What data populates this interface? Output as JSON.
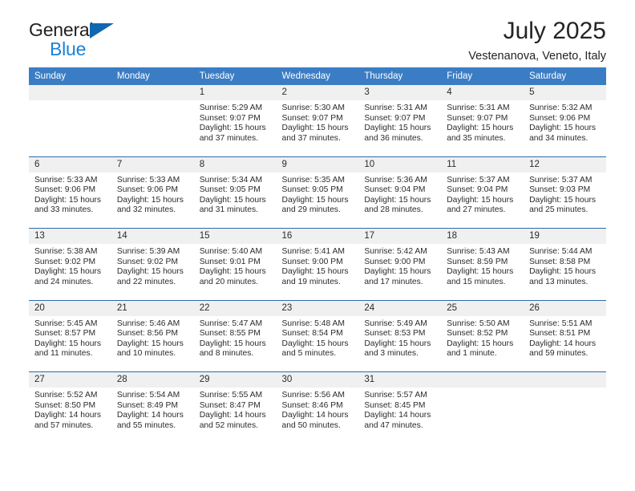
{
  "brand": {
    "line1": "General",
    "line2": "Blue",
    "triangle_color": "#0f67b1",
    "blue_text_color": "#1a82d6"
  },
  "header": {
    "month_title": "July 2025",
    "location": "Vestenanova, Veneto, Italy"
  },
  "theme": {
    "header_band": "#3b7dc4",
    "cell_top_border": "#2d6ca9",
    "daynum_band": "#f0f0f0"
  },
  "weekday_headers": [
    "Sunday",
    "Monday",
    "Tuesday",
    "Wednesday",
    "Thursday",
    "Friday",
    "Saturday"
  ],
  "weeks": [
    [
      {
        "day": "",
        "sunrise": "",
        "sunset": "",
        "daylight": "",
        "empty": true
      },
      {
        "day": "",
        "sunrise": "",
        "sunset": "",
        "daylight": "",
        "empty": true
      },
      {
        "day": "1",
        "sunrise": "Sunrise: 5:29 AM",
        "sunset": "Sunset: 9:07 PM",
        "daylight": "Daylight: 15 hours and 37 minutes."
      },
      {
        "day": "2",
        "sunrise": "Sunrise: 5:30 AM",
        "sunset": "Sunset: 9:07 PM",
        "daylight": "Daylight: 15 hours and 37 minutes."
      },
      {
        "day": "3",
        "sunrise": "Sunrise: 5:31 AM",
        "sunset": "Sunset: 9:07 PM",
        "daylight": "Daylight: 15 hours and 36 minutes."
      },
      {
        "day": "4",
        "sunrise": "Sunrise: 5:31 AM",
        "sunset": "Sunset: 9:07 PM",
        "daylight": "Daylight: 15 hours and 35 minutes."
      },
      {
        "day": "5",
        "sunrise": "Sunrise: 5:32 AM",
        "sunset": "Sunset: 9:06 PM",
        "daylight": "Daylight: 15 hours and 34 minutes."
      }
    ],
    [
      {
        "day": "6",
        "sunrise": "Sunrise: 5:33 AM",
        "sunset": "Sunset: 9:06 PM",
        "daylight": "Daylight: 15 hours and 33 minutes."
      },
      {
        "day": "7",
        "sunrise": "Sunrise: 5:33 AM",
        "sunset": "Sunset: 9:06 PM",
        "daylight": "Daylight: 15 hours and 32 minutes."
      },
      {
        "day": "8",
        "sunrise": "Sunrise: 5:34 AM",
        "sunset": "Sunset: 9:05 PM",
        "daylight": "Daylight: 15 hours and 31 minutes."
      },
      {
        "day": "9",
        "sunrise": "Sunrise: 5:35 AM",
        "sunset": "Sunset: 9:05 PM",
        "daylight": "Daylight: 15 hours and 29 minutes."
      },
      {
        "day": "10",
        "sunrise": "Sunrise: 5:36 AM",
        "sunset": "Sunset: 9:04 PM",
        "daylight": "Daylight: 15 hours and 28 minutes."
      },
      {
        "day": "11",
        "sunrise": "Sunrise: 5:37 AM",
        "sunset": "Sunset: 9:04 PM",
        "daylight": "Daylight: 15 hours and 27 minutes."
      },
      {
        "day": "12",
        "sunrise": "Sunrise: 5:37 AM",
        "sunset": "Sunset: 9:03 PM",
        "daylight": "Daylight: 15 hours and 25 minutes."
      }
    ],
    [
      {
        "day": "13",
        "sunrise": "Sunrise: 5:38 AM",
        "sunset": "Sunset: 9:02 PM",
        "daylight": "Daylight: 15 hours and 24 minutes."
      },
      {
        "day": "14",
        "sunrise": "Sunrise: 5:39 AM",
        "sunset": "Sunset: 9:02 PM",
        "daylight": "Daylight: 15 hours and 22 minutes."
      },
      {
        "day": "15",
        "sunrise": "Sunrise: 5:40 AM",
        "sunset": "Sunset: 9:01 PM",
        "daylight": "Daylight: 15 hours and 20 minutes."
      },
      {
        "day": "16",
        "sunrise": "Sunrise: 5:41 AM",
        "sunset": "Sunset: 9:00 PM",
        "daylight": "Daylight: 15 hours and 19 minutes."
      },
      {
        "day": "17",
        "sunrise": "Sunrise: 5:42 AM",
        "sunset": "Sunset: 9:00 PM",
        "daylight": "Daylight: 15 hours and 17 minutes."
      },
      {
        "day": "18",
        "sunrise": "Sunrise: 5:43 AM",
        "sunset": "Sunset: 8:59 PM",
        "daylight": "Daylight: 15 hours and 15 minutes."
      },
      {
        "day": "19",
        "sunrise": "Sunrise: 5:44 AM",
        "sunset": "Sunset: 8:58 PM",
        "daylight": "Daylight: 15 hours and 13 minutes."
      }
    ],
    [
      {
        "day": "20",
        "sunrise": "Sunrise: 5:45 AM",
        "sunset": "Sunset: 8:57 PM",
        "daylight": "Daylight: 15 hours and 11 minutes."
      },
      {
        "day": "21",
        "sunrise": "Sunrise: 5:46 AM",
        "sunset": "Sunset: 8:56 PM",
        "daylight": "Daylight: 15 hours and 10 minutes."
      },
      {
        "day": "22",
        "sunrise": "Sunrise: 5:47 AM",
        "sunset": "Sunset: 8:55 PM",
        "daylight": "Daylight: 15 hours and 8 minutes."
      },
      {
        "day": "23",
        "sunrise": "Sunrise: 5:48 AM",
        "sunset": "Sunset: 8:54 PM",
        "daylight": "Daylight: 15 hours and 5 minutes."
      },
      {
        "day": "24",
        "sunrise": "Sunrise: 5:49 AM",
        "sunset": "Sunset: 8:53 PM",
        "daylight": "Daylight: 15 hours and 3 minutes."
      },
      {
        "day": "25",
        "sunrise": "Sunrise: 5:50 AM",
        "sunset": "Sunset: 8:52 PM",
        "daylight": "Daylight: 15 hours and 1 minute."
      },
      {
        "day": "26",
        "sunrise": "Sunrise: 5:51 AM",
        "sunset": "Sunset: 8:51 PM",
        "daylight": "Daylight: 14 hours and 59 minutes."
      }
    ],
    [
      {
        "day": "27",
        "sunrise": "Sunrise: 5:52 AM",
        "sunset": "Sunset: 8:50 PM",
        "daylight": "Daylight: 14 hours and 57 minutes."
      },
      {
        "day": "28",
        "sunrise": "Sunrise: 5:54 AM",
        "sunset": "Sunset: 8:49 PM",
        "daylight": "Daylight: 14 hours and 55 minutes."
      },
      {
        "day": "29",
        "sunrise": "Sunrise: 5:55 AM",
        "sunset": "Sunset: 8:47 PM",
        "daylight": "Daylight: 14 hours and 52 minutes."
      },
      {
        "day": "30",
        "sunrise": "Sunrise: 5:56 AM",
        "sunset": "Sunset: 8:46 PM",
        "daylight": "Daylight: 14 hours and 50 minutes."
      },
      {
        "day": "31",
        "sunrise": "Sunrise: 5:57 AM",
        "sunset": "Sunset: 8:45 PM",
        "daylight": "Daylight: 14 hours and 47 minutes."
      },
      {
        "day": "",
        "sunrise": "",
        "sunset": "",
        "daylight": "",
        "empty": true
      },
      {
        "day": "",
        "sunrise": "",
        "sunset": "",
        "daylight": "",
        "empty": true
      }
    ]
  ]
}
